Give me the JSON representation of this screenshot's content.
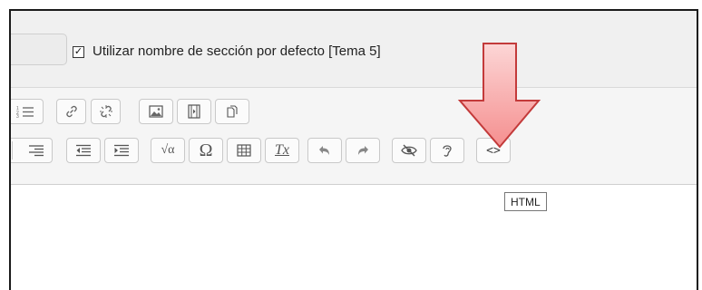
{
  "section": {
    "use_default_label": "Utilizar nombre de sección por defecto [Tema 5]",
    "use_default_checked": true
  },
  "toolbar": {
    "row1": [
      "numbered-list",
      "link",
      "unlink",
      "image",
      "media",
      "manage-files"
    ],
    "row2": [
      "align-right",
      "outdent",
      "indent",
      "equation",
      "special-character",
      "table",
      "clear-formatting",
      "undo",
      "redo",
      "accessibility-checker",
      "screenreader-helper",
      "html"
    ],
    "special_char_glyph": "Ω",
    "equation_glyph": "√α",
    "clear_format_glyph": "Tx",
    "html_glyph": "<>"
  },
  "tooltip": {
    "text": "HTML"
  },
  "colors": {
    "arrow_fill": "#f6a0a0",
    "arrow_stroke": "#c33a3a"
  }
}
